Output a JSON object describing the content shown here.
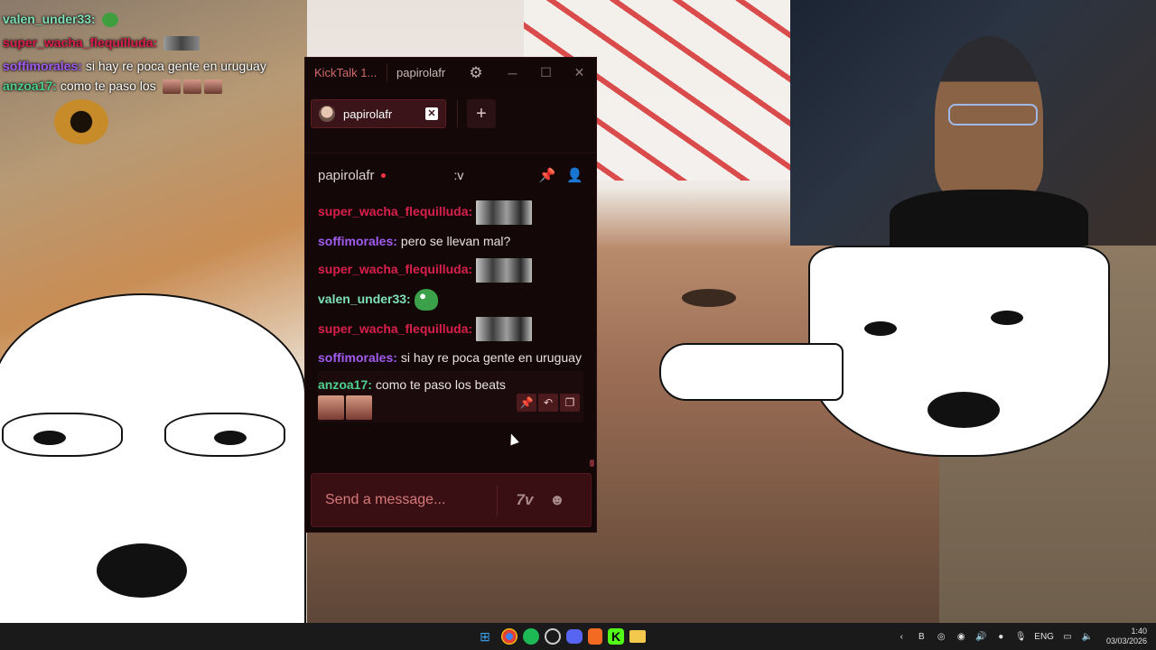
{
  "overlay_chat": [
    {
      "user": "valen_under33:",
      "text": "",
      "user_color": "#7ee0b8",
      "emote": "pepe"
    },
    {
      "user": "super_wacha_flequilluda:",
      "text": "",
      "user_color": "#d9204c",
      "emote": "wide"
    },
    {
      "user": "soffimorales:",
      "text": "si hay re poca gente en uruguay",
      "user_color": "#a15cf0"
    },
    {
      "user": "anzoa17:",
      "text": "como te paso los",
      "user_color": "#4fcf8f",
      "emote": "faces"
    }
  ],
  "window": {
    "app_title": "KickTalk 1...",
    "title_user": "papirolafr",
    "settings_icon": "gear-icon",
    "minimize": "─",
    "maximize": "☐",
    "close": "✕"
  },
  "tabs": [
    {
      "label": "papirolafr",
      "close": "✕"
    }
  ],
  "add_tab": "+",
  "channel": {
    "name": "papirolafr",
    "title": ":v",
    "live_color": "#ff3344"
  },
  "messages": [
    {
      "user": "super_wacha_flequilluda:",
      "user_color": "#d9204c",
      "text": "",
      "emote": "wide"
    },
    {
      "user": "soffimorales:",
      "user_color": "#a15cf0",
      "text": "pero se llevan mal?"
    },
    {
      "user": "super_wacha_flequilluda:",
      "user_color": "#d9204c",
      "text": "",
      "emote": "wide"
    },
    {
      "user": "valen_under33:",
      "user_color": "#7ee0b8",
      "text": "",
      "emote": "pepe"
    },
    {
      "user": "super_wacha_flequilluda:",
      "user_color": "#d9204c",
      "text": "",
      "emote": "wide"
    },
    {
      "user": "soffimorales:",
      "user_color": "#a15cf0",
      "text": "si hay re poca gente en uruguay"
    },
    {
      "user": "anzoa17:",
      "user_color": "#4fcf8f",
      "text": "como te paso los beats",
      "emote": "faces"
    }
  ],
  "input": {
    "placeholder": "Send a message..."
  },
  "taskbar": {
    "apps": [
      "windows-start",
      "chrome",
      "spotify",
      "obs",
      "discord",
      "brave",
      "kick",
      "file-explorer"
    ],
    "lang": "ENG",
    "time": "1:40",
    "date": "03/03/2026"
  }
}
